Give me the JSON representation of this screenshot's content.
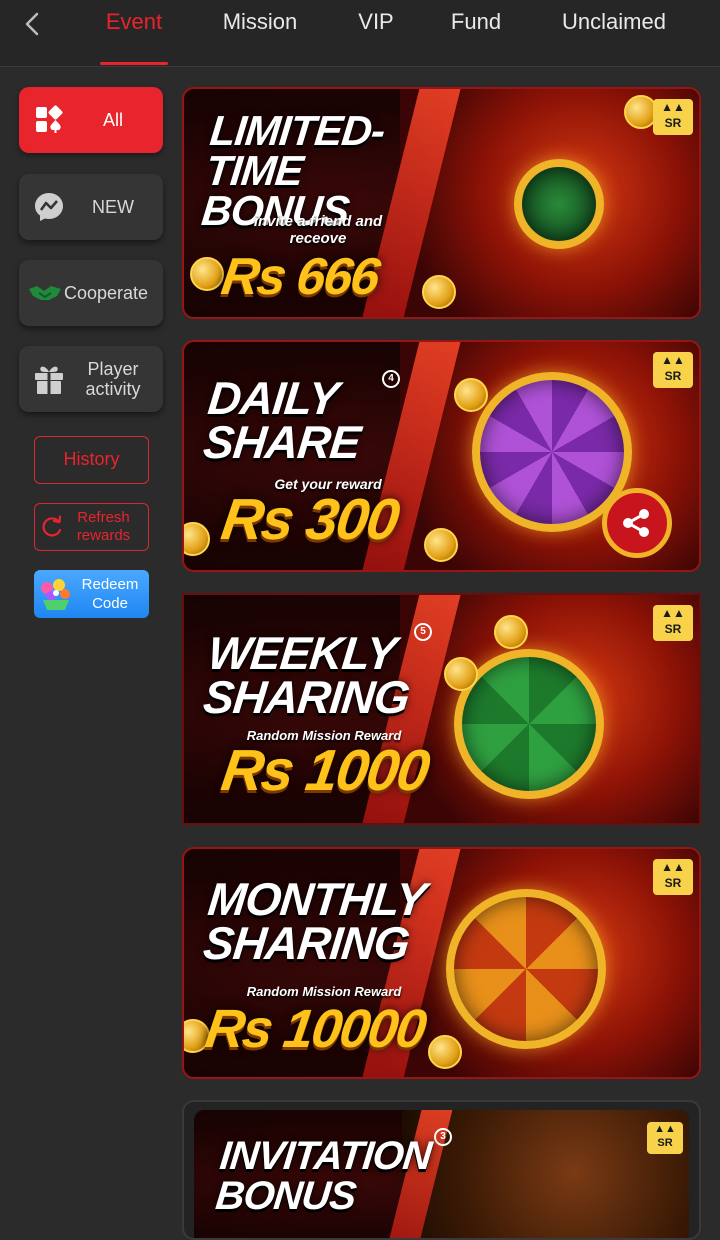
{
  "tabs": [
    {
      "label": "Event",
      "active": true
    },
    {
      "label": "Mission",
      "active": false
    },
    {
      "label": "VIP",
      "active": false
    },
    {
      "label": "Fund",
      "active": false
    },
    {
      "label": "Unclaimed",
      "active": false
    }
  ],
  "sidebar": {
    "items": [
      {
        "label": "All",
        "icon": "grid-spade-icon",
        "active": true
      },
      {
        "label": "NEW",
        "icon": "messenger-icon",
        "active": false
      },
      {
        "label": "Cooperate",
        "icon": "handshake-icon",
        "active": false
      },
      {
        "label": "Player activity",
        "icon": "gift-icon",
        "active": false
      }
    ],
    "history_label": "History",
    "refresh_label": "Refresh rewards",
    "redeem_label": "Redeem Code"
  },
  "banners": [
    {
      "title": "LIMITED-TIME BONUS",
      "subtitle": "invite a friend and receove",
      "amount": "Rs 666"
    },
    {
      "title": "DAILY SHARE",
      "subtitle": "Get your reward",
      "amount": "Rs 300"
    },
    {
      "title": "WEEKLY SHARING",
      "subtitle": "Random Mission Reward",
      "amount": "Rs 1000"
    },
    {
      "title": "MONTHLY SHARING",
      "subtitle": "Random Mission Reward",
      "amount": "Rs 10000"
    },
    {
      "title": "INVITATION BONUS",
      "subtitle": "",
      "amount": ""
    }
  ],
  "colors": {
    "accent": "#e8242c",
    "background": "#2b2b2c",
    "gold": "#ffc21a",
    "redeem_blue": "#2a8ef5"
  }
}
